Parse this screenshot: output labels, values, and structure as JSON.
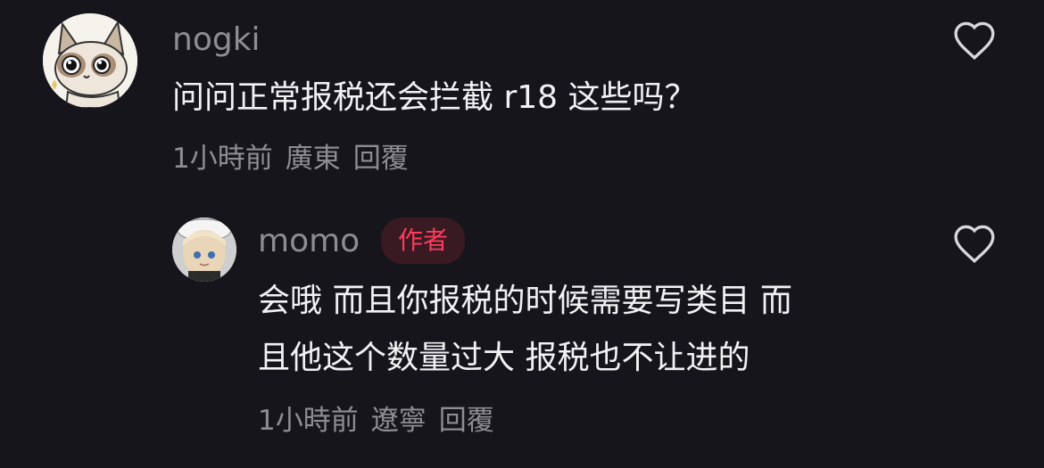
{
  "comments": [
    {
      "username": "nogki",
      "text": "问问正常报税还会拦截 r18 这些吗？",
      "time": "1小時前",
      "location": "廣東",
      "reply_label": "回覆"
    }
  ],
  "reply": {
    "username": "momo",
    "author_badge": "作者",
    "text_line1": "会哦 而且你报税的时候需要写类目 而",
    "text_line2": "且他这个数量过大 报税也不让进的",
    "time": "1小時前",
    "location": "遼寧",
    "reply_label": "回覆"
  },
  "colors": {
    "background": "#16151c",
    "username": "#8e8d94",
    "text": "#f2f2f4",
    "badge_bg": "#3a1a22",
    "badge_text": "#ff3b5c"
  },
  "icons": [
    "cat-avatar-icon",
    "doll-avatar-icon",
    "heart-icon"
  ]
}
